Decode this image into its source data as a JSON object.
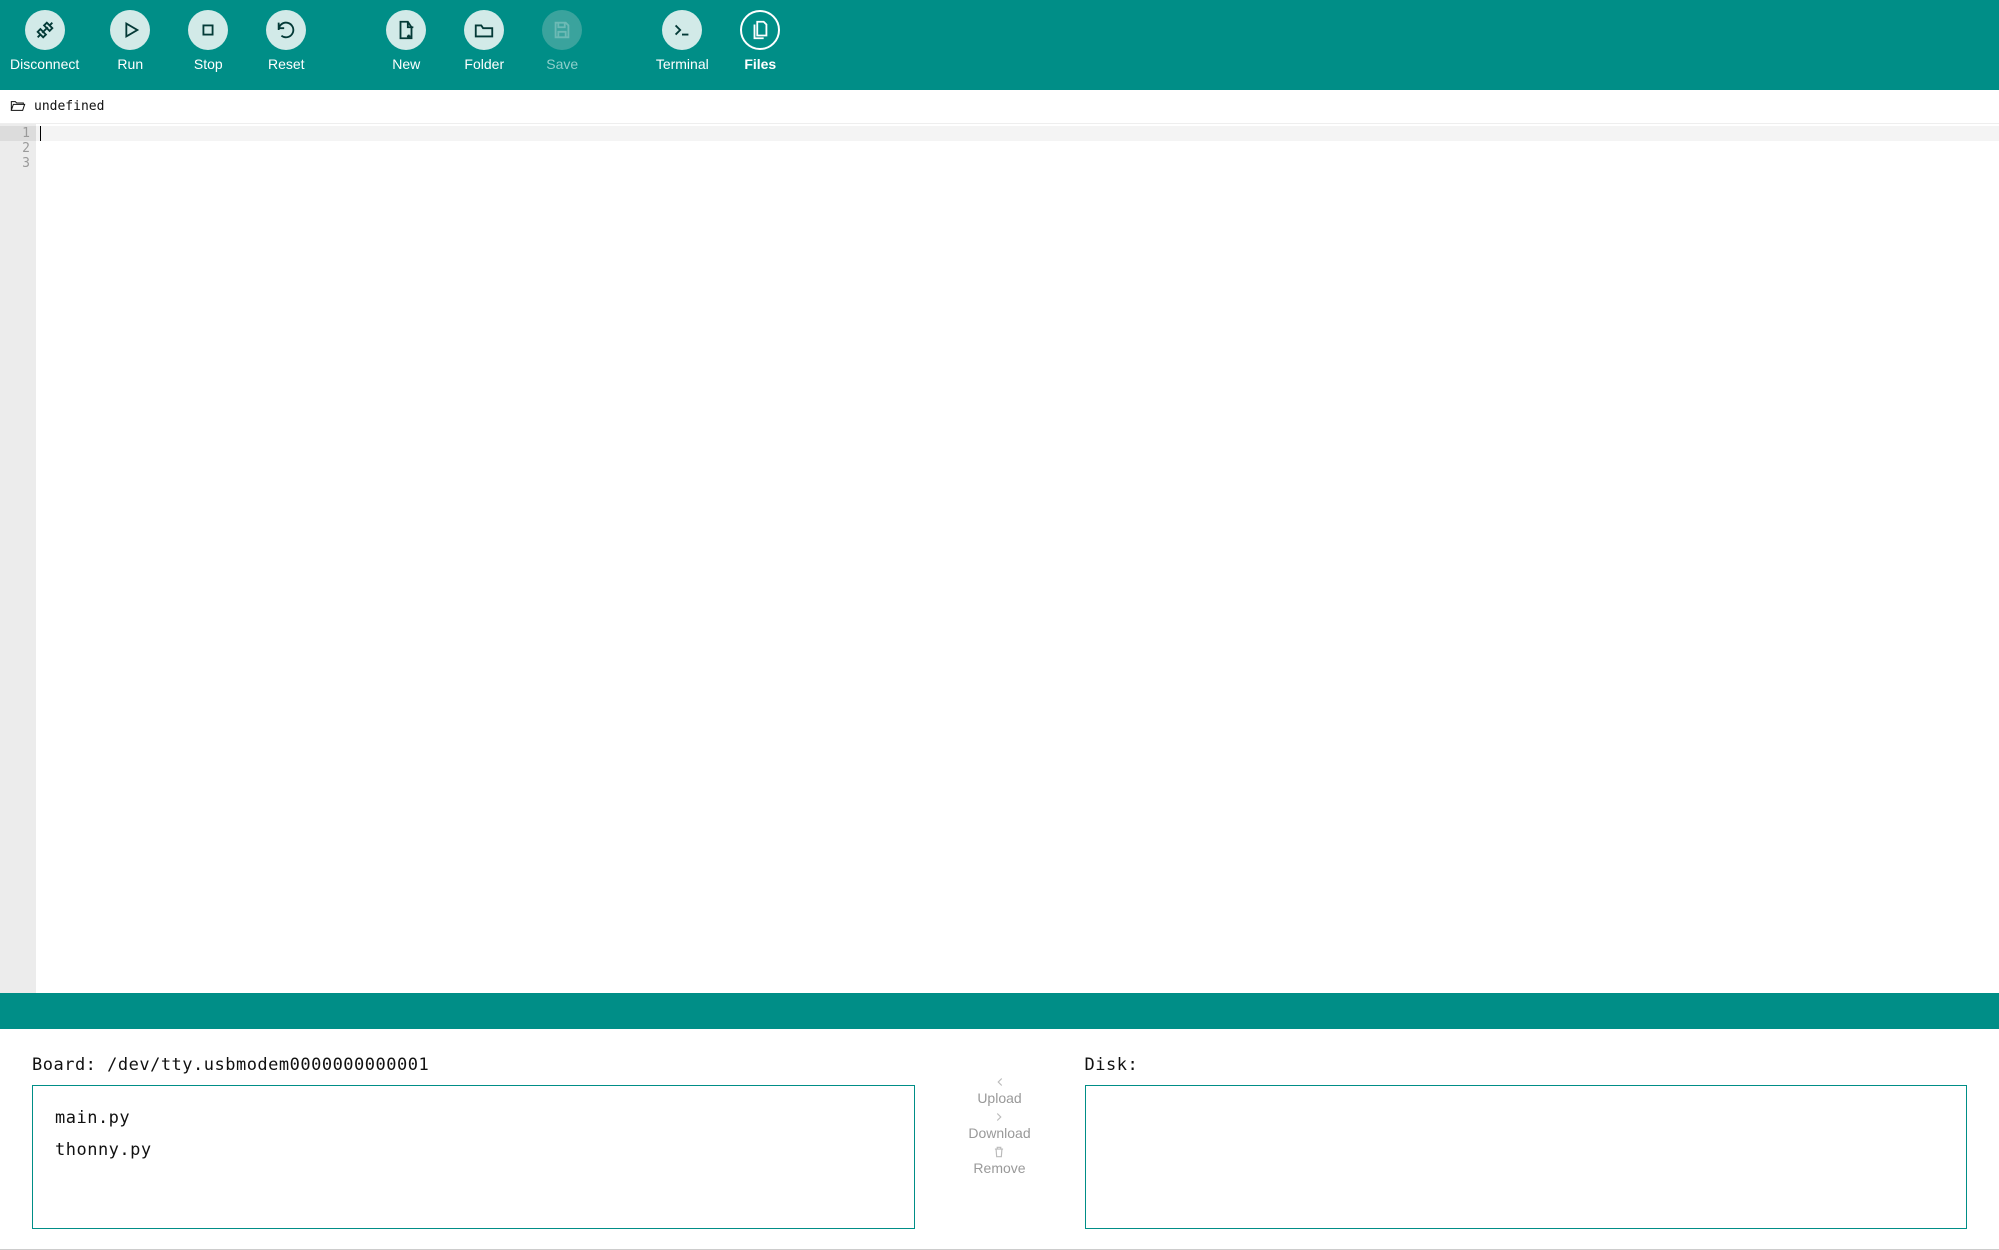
{
  "toolbar": {
    "disconnect": "Disconnect",
    "run": "Run",
    "stop": "Stop",
    "reset": "Reset",
    "new": "New",
    "folder": "Folder",
    "save": "Save",
    "terminal": "Terminal",
    "files": "Files"
  },
  "file_tab": {
    "name": "undefined"
  },
  "editor": {
    "line_numbers": [
      "1",
      "2",
      "3"
    ],
    "content": ""
  },
  "files_panel": {
    "board_label": "Board: /dev/tty.usbmodem0000000000001",
    "disk_label": "Disk:",
    "board_files": [
      "main.py",
      "thonny.py"
    ],
    "disk_files": [],
    "upload_label": "Upload",
    "download_label": "Download",
    "remove_label": "Remove"
  }
}
